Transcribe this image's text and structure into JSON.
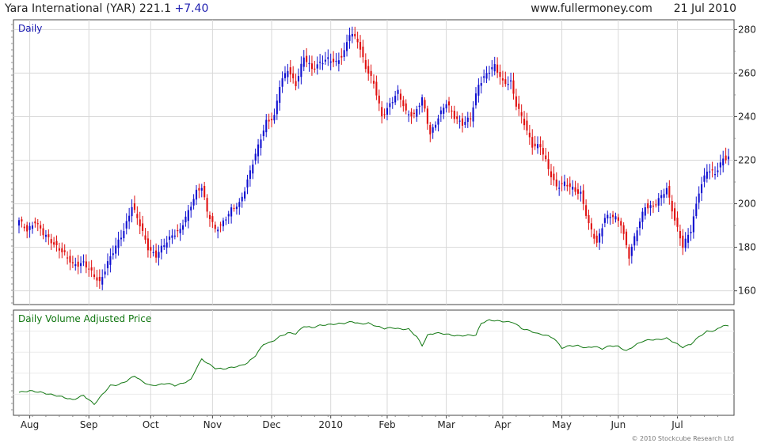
{
  "header": {
    "title": "Yara International (YAR) 221.1",
    "change": "+7.40",
    "site": "www.fullermoney.com",
    "date": "21 Jul 2010"
  },
  "colors": {
    "up": "#1010d0",
    "down": "#e01010",
    "vap_line": "#117711",
    "grid": "#d8d8d8",
    "panel_label_price": "#1515b0",
    "panel_label_vap": "#117711"
  },
  "chart_data": [
    {
      "type": "candlestick",
      "title": "Daily",
      "y_ticks": [
        160,
        180,
        200,
        220,
        240,
        260,
        280
      ],
      "ylim": [
        153.7,
        284.5
      ],
      "grid": true,
      "x_tick_labels": [
        "Aug",
        "Sep",
        "Oct",
        "Nov",
        "Dec",
        "2010",
        "Feb",
        "Mar",
        "Apr",
        "May",
        "Jun",
        "Jul"
      ],
      "anchor_series": [
        {
          "t": 0,
          "v": 192
        },
        {
          "t": 3,
          "v": 188
        },
        {
          "t": 6,
          "v": 192
        },
        {
          "t": 9,
          "v": 186
        },
        {
          "t": 12,
          "v": 183
        },
        {
          "t": 16,
          "v": 178
        },
        {
          "t": 20,
          "v": 172
        },
        {
          "t": 24,
          "v": 173
        },
        {
          "t": 27,
          "v": 168
        },
        {
          "t": 30,
          "v": 164
        },
        {
          "t": 33,
          "v": 173
        },
        {
          "t": 36,
          "v": 180
        },
        {
          "t": 39,
          "v": 188
        },
        {
          "t": 42,
          "v": 199
        },
        {
          "t": 45,
          "v": 190
        },
        {
          "t": 48,
          "v": 180
        },
        {
          "t": 51,
          "v": 176
        },
        {
          "t": 54,
          "v": 181
        },
        {
          "t": 57,
          "v": 186
        },
        {
          "t": 60,
          "v": 188
        },
        {
          "t": 63,
          "v": 196
        },
        {
          "t": 66,
          "v": 206
        },
        {
          "t": 68,
          "v": 208
        },
        {
          "t": 70,
          "v": 196
        },
        {
          "t": 73,
          "v": 188
        },
        {
          "t": 76,
          "v": 192
        },
        {
          "t": 79,
          "v": 197
        },
        {
          "t": 82,
          "v": 200
        },
        {
          "t": 84,
          "v": 207
        },
        {
          "t": 86,
          "v": 215
        },
        {
          "t": 89,
          "v": 226
        },
        {
          "t": 92,
          "v": 238
        },
        {
          "t": 95,
          "v": 240
        },
        {
          "t": 97,
          "v": 254
        },
        {
          "t": 100,
          "v": 262
        },
        {
          "t": 103,
          "v": 255
        },
        {
          "t": 106,
          "v": 267
        },
        {
          "t": 109,
          "v": 262
        },
        {
          "t": 112,
          "v": 265
        },
        {
          "t": 115,
          "v": 266
        },
        {
          "t": 118,
          "v": 265
        },
        {
          "t": 121,
          "v": 270
        },
        {
          "t": 123,
          "v": 278
        },
        {
          "t": 126,
          "v": 275
        },
        {
          "t": 129,
          "v": 263
        },
        {
          "t": 132,
          "v": 255
        },
        {
          "t": 135,
          "v": 240
        },
        {
          "t": 138,
          "v": 246
        },
        {
          "t": 141,
          "v": 251
        },
        {
          "t": 144,
          "v": 242
        },
        {
          "t": 147,
          "v": 241
        },
        {
          "t": 150,
          "v": 248
        },
        {
          "t": 153,
          "v": 232
        },
        {
          "t": 156,
          "v": 240
        },
        {
          "t": 159,
          "v": 246
        },
        {
          "t": 162,
          "v": 240
        },
        {
          "t": 165,
          "v": 237
        },
        {
          "t": 168,
          "v": 239
        },
        {
          "t": 171,
          "v": 255
        },
        {
          "t": 174,
          "v": 260
        },
        {
          "t": 177,
          "v": 263
        },
        {
          "t": 180,
          "v": 256
        },
        {
          "t": 183,
          "v": 256
        },
        {
          "t": 185,
          "v": 245
        },
        {
          "t": 188,
          "v": 237
        },
        {
          "t": 191,
          "v": 227
        },
        {
          "t": 194,
          "v": 226
        },
        {
          "t": 197,
          "v": 216
        },
        {
          "t": 200,
          "v": 208
        },
        {
          "t": 203,
          "v": 209
        },
        {
          "t": 206,
          "v": 207
        },
        {
          "t": 209,
          "v": 205
        },
        {
          "t": 212,
          "v": 190
        },
        {
          "t": 215,
          "v": 182
        },
        {
          "t": 218,
          "v": 194
        },
        {
          "t": 221,
          "v": 194
        },
        {
          "t": 224,
          "v": 191
        },
        {
          "t": 227,
          "v": 176
        },
        {
          "t": 230,
          "v": 188
        },
        {
          "t": 233,
          "v": 199
        },
        {
          "t": 236,
          "v": 199
        },
        {
          "t": 239,
          "v": 203
        },
        {
          "t": 241,
          "v": 207
        },
        {
          "t": 244,
          "v": 193
        },
        {
          "t": 247,
          "v": 180
        },
        {
          "t": 250,
          "v": 188
        },
        {
          "t": 253,
          "v": 206
        },
        {
          "t": 256,
          "v": 215
        },
        {
          "t": 259,
          "v": 214
        },
        {
          "t": 262,
          "v": 221
        },
        {
          "t": 264,
          "v": 221
        }
      ]
    },
    {
      "type": "line",
      "title": "Daily Volume Adjusted Price",
      "ylim": [
        0,
        100
      ],
      "grid": true,
      "anchor_series": [
        {
          "t": 0,
          "v": 18
        },
        {
          "t": 4,
          "v": 20
        },
        {
          "t": 8,
          "v": 18
        },
        {
          "t": 12,
          "v": 15
        },
        {
          "t": 16,
          "v": 12
        },
        {
          "t": 20,
          "v": 8
        },
        {
          "t": 24,
          "v": 14
        },
        {
          "t": 28,
          "v": 2
        },
        {
          "t": 31,
          "v": 15
        },
        {
          "t": 34,
          "v": 27
        },
        {
          "t": 37,
          "v": 28
        },
        {
          "t": 40,
          "v": 33
        },
        {
          "t": 43,
          "v": 40
        },
        {
          "t": 46,
          "v": 32
        },
        {
          "t": 49,
          "v": 27
        },
        {
          "t": 52,
          "v": 28
        },
        {
          "t": 55,
          "v": 30
        },
        {
          "t": 58,
          "v": 27
        },
        {
          "t": 61,
          "v": 30
        },
        {
          "t": 64,
          "v": 35
        },
        {
          "t": 66,
          "v": 50
        },
        {
          "t": 68,
          "v": 62
        },
        {
          "t": 70,
          "v": 57
        },
        {
          "t": 73,
          "v": 50
        },
        {
          "t": 76,
          "v": 49
        },
        {
          "t": 79,
          "v": 51
        },
        {
          "t": 82,
          "v": 53
        },
        {
          "t": 85,
          "v": 57
        },
        {
          "t": 88,
          "v": 67
        },
        {
          "t": 91,
          "v": 82
        },
        {
          "t": 94,
          "v": 85
        },
        {
          "t": 97,
          "v": 92
        },
        {
          "t": 100,
          "v": 97
        },
        {
          "t": 103,
          "v": 96
        },
        {
          "t": 106,
          "v": 106
        },
        {
          "t": 109,
          "v": 104
        },
        {
          "t": 112,
          "v": 107
        },
        {
          "t": 115,
          "v": 108
        },
        {
          "t": 118,
          "v": 109
        },
        {
          "t": 121,
          "v": 110
        },
        {
          "t": 124,
          "v": 112
        },
        {
          "t": 127,
          "v": 109
        },
        {
          "t": 130,
          "v": 110
        },
        {
          "t": 133,
          "v": 106
        },
        {
          "t": 136,
          "v": 103
        },
        {
          "t": 139,
          "v": 104
        },
        {
          "t": 142,
          "v": 102
        },
        {
          "t": 145,
          "v": 102
        },
        {
          "t": 148,
          "v": 92
        },
        {
          "t": 150,
          "v": 80
        },
        {
          "t": 152,
          "v": 94
        },
        {
          "t": 155,
          "v": 97
        },
        {
          "t": 158,
          "v": 96
        },
        {
          "t": 161,
          "v": 94
        },
        {
          "t": 164,
          "v": 93
        },
        {
          "t": 167,
          "v": 94
        },
        {
          "t": 170,
          "v": 94
        },
        {
          "t": 172,
          "v": 110
        },
        {
          "t": 175,
          "v": 114
        },
        {
          "t": 178,
          "v": 113
        },
        {
          "t": 181,
          "v": 112
        },
        {
          "t": 184,
          "v": 111
        },
        {
          "t": 187,
          "v": 103
        },
        {
          "t": 190,
          "v": 100
        },
        {
          "t": 193,
          "v": 96
        },
        {
          "t": 196,
          "v": 94
        },
        {
          "t": 199,
          "v": 90
        },
        {
          "t": 202,
          "v": 77
        },
        {
          "t": 205,
          "v": 80
        },
        {
          "t": 208,
          "v": 80
        },
        {
          "t": 211,
          "v": 77
        },
        {
          "t": 214,
          "v": 79
        },
        {
          "t": 217,
          "v": 76
        },
        {
          "t": 220,
          "v": 80
        },
        {
          "t": 223,
          "v": 79
        },
        {
          "t": 226,
          "v": 73
        },
        {
          "t": 229,
          "v": 80
        },
        {
          "t": 232,
          "v": 86
        },
        {
          "t": 235,
          "v": 88
        },
        {
          "t": 238,
          "v": 88
        },
        {
          "t": 241,
          "v": 90
        },
        {
          "t": 244,
          "v": 84
        },
        {
          "t": 247,
          "v": 78
        },
        {
          "t": 250,
          "v": 82
        },
        {
          "t": 253,
          "v": 92
        },
        {
          "t": 256,
          "v": 99
        },
        {
          "t": 259,
          "v": 100
        },
        {
          "t": 262,
          "v": 107
        },
        {
          "t": 264,
          "v": 106
        }
      ]
    }
  ],
  "axis": {
    "month_t": [
      4,
      26,
      49,
      72,
      94,
      116,
      137,
      159,
      180,
      202,
      223,
      245
    ],
    "footer": "© 2010 Stockcube Research Ltd"
  }
}
